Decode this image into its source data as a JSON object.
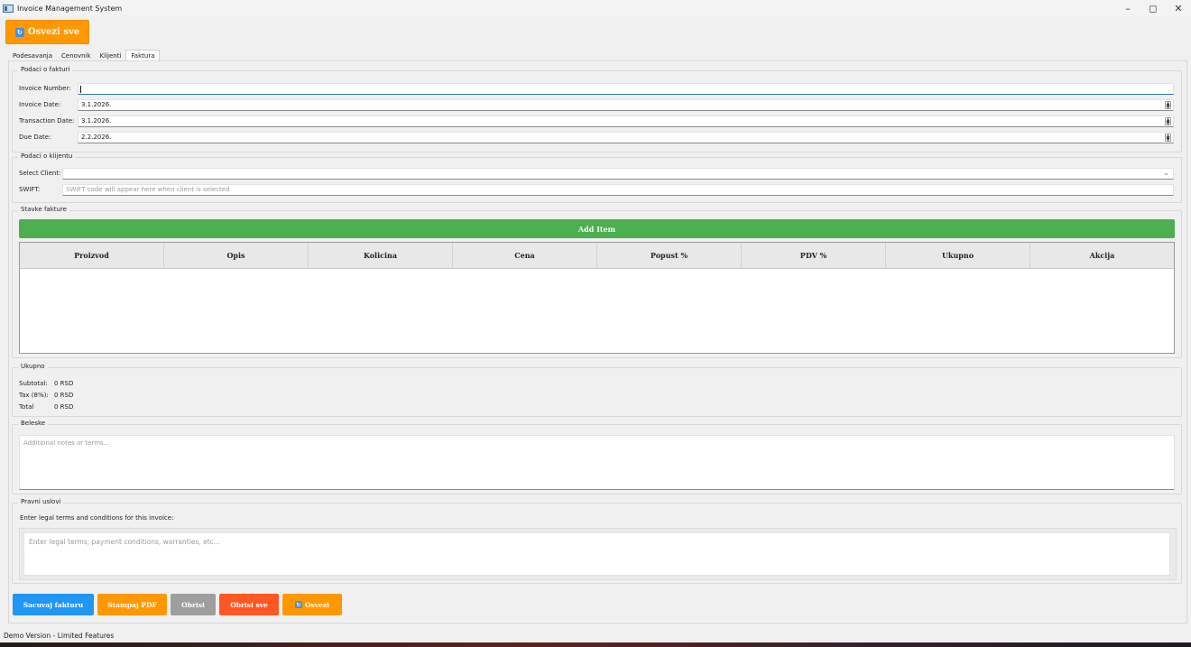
{
  "window": {
    "title": "Invoice Management System",
    "controls": [
      "–",
      "◻",
      "✕"
    ]
  },
  "toolbar": {
    "refresh_all_label": "Osvezi sve"
  },
  "tabs": [
    {
      "label": "Podesavanja",
      "active": false
    },
    {
      "label": "Cenovnik",
      "active": false
    },
    {
      "label": "Klijenti",
      "active": false
    },
    {
      "label": "Faktura",
      "active": true
    }
  ],
  "invoice_info": {
    "title": "Podaci o fakturi",
    "invoice_number_label": "Invoice Number:",
    "invoice_number_value": "",
    "invoice_date_label": "Invoice Date:",
    "invoice_date_value": "3.1.2026.",
    "transaction_date_label": "Transaction Date:",
    "transaction_date_value": "3.1.2026.",
    "due_date_label": "Due Date:",
    "due_date_value": "2.2.2026."
  },
  "client_info": {
    "title": "Podaci o klijentu",
    "select_client_label": "Select Client:",
    "select_client_value": "",
    "swift_label": "SWIFT:",
    "swift_placeholder": "SWIFT code will appear here when client is selected"
  },
  "items": {
    "title": "Stavke fakture",
    "add_item_label": "Add Item",
    "columns": [
      "Proizvod",
      "Opis",
      "Kolicina",
      "Cena",
      "Popust %",
      "PDV %",
      "Ukupno",
      "Akcija"
    ],
    "rows": []
  },
  "totals": {
    "title": "Ukupno",
    "subtotal_label": "Subtotal:",
    "subtotal_value": "0 RSD",
    "tax_label": "Tax (8%):",
    "tax_value": "0 RSD",
    "total_label": "Total",
    "total_value": "0 RSD"
  },
  "notes": {
    "title": "Beleske",
    "placeholder": "Additional notes or terms..."
  },
  "legal": {
    "title": "Pravni uslovi",
    "instruction": "Enter legal terms and conditions for this invoice:",
    "placeholder": "Enter legal terms, payment conditions, warranties, etc..."
  },
  "actions": {
    "save_label": "Sacuvaj fakturu",
    "print_label": "Stampaj PDF",
    "delete_label": "Obrisi",
    "delete_all_label": "Obrisi sve",
    "refresh_label": "Osvezi"
  },
  "colors": {
    "orange": "#ff9800",
    "green": "#4caf50",
    "blue": "#2196f3",
    "grey": "#9e9e9e",
    "red": "#ff5722"
  },
  "status": {
    "text": "Demo Version - Limited Features"
  }
}
